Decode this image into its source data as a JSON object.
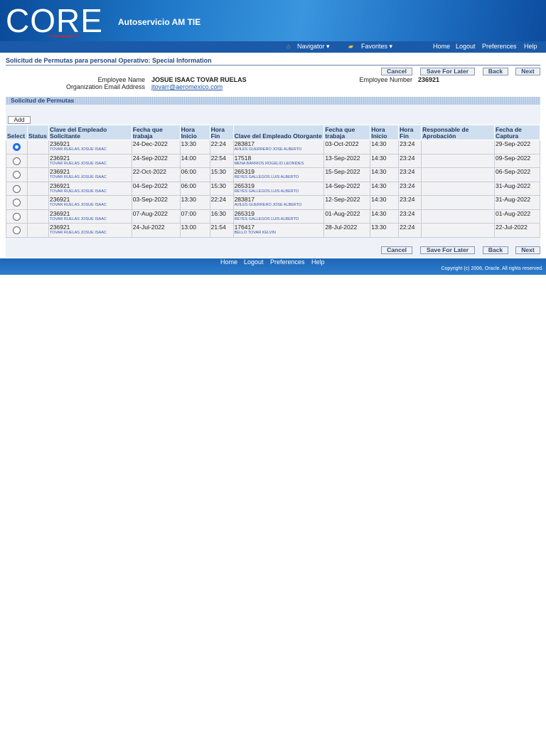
{
  "header": {
    "logo": "CORE",
    "app_title": "Autoservicio AM TIE"
  },
  "nav": {
    "navigator": "Navigator",
    "favorites": "Favorites",
    "home": "Home",
    "logout": "Logout",
    "preferences": "Preferences",
    "help": "Help"
  },
  "page": {
    "title": "Solicitud de Permutas para personal Operativo: Special Information"
  },
  "buttons": {
    "cancel": "Cancel",
    "save": "Save For Later",
    "back": "Back",
    "next": "Next",
    "add": "Add"
  },
  "employee": {
    "name_label": "Employee Name",
    "name": "JOSUE ISAAC TOVAR RUELAS",
    "email_label": "Organization Email Address",
    "email": "jtovarr@aeromexico.com",
    "number_label": "Employee Number",
    "number": "236921"
  },
  "section": {
    "title": "Solicitud de Permutas"
  },
  "table": {
    "headers": [
      "Select",
      "Status",
      "Clave del Empleado Solicitante",
      "Fecha que trabaja",
      "Hora Inicio",
      "Hora Fin",
      "Clave del Empleado Otorgante",
      "Fecha que trabaja",
      "Hora Inicio",
      "Hora Fin",
      "Responsable de Aprobación",
      "Fecha de Captura"
    ],
    "rows": [
      {
        "selected": true,
        "sol_id": "236921",
        "sol_name": "TOVAR RUELAS JOSUE ISAAC",
        "fecha1": "24-Dec-2022",
        "ini1": "13:30",
        "fin1": "22:24",
        "otg_id": "283817",
        "otg_name": "AVILES GUERRERO JOSE ALBERTO",
        "fecha2": "03-Oct-2022",
        "ini2": "14:30",
        "fin2": "23:24",
        "resp": "",
        "captura": "29-Sep-2022"
      },
      {
        "selected": false,
        "sol_id": "236921",
        "sol_name": "TOVAR RUELAS JOSUE ISAAC",
        "fecha1": "24-Sep-2022",
        "ini1": "14:00",
        "fin1": "22:54",
        "otg_id": "17518",
        "otg_name": "MENA BARRIOS ROGELIO LEONIDES",
        "fecha2": "13-Sep-2022",
        "ini2": "14:30",
        "fin2": "23:24",
        "resp": "",
        "captura": "09-Sep-2022"
      },
      {
        "selected": false,
        "sol_id": "236921",
        "sol_name": "TOVAR RUELAS JOSUE ISAAC",
        "fecha1": "22-Oct-2022",
        "ini1": "06:00",
        "fin1": "15:30",
        "otg_id": "265319",
        "otg_name": "REYES GALLEGOS LUIS ALBERTO",
        "fecha2": "15-Sep-2022",
        "ini2": "14:30",
        "fin2": "23:24",
        "resp": "",
        "captura": "06-Sep-2022"
      },
      {
        "selected": false,
        "sol_id": "236921",
        "sol_name": "TOVAR RUELAS JOSUE ISAAC",
        "fecha1": "04-Sep-2022",
        "ini1": "06:00",
        "fin1": "15:30",
        "otg_id": "265319",
        "otg_name": "REYES GALLEGOS LUIS ALBERTO",
        "fecha2": "14-Sep-2022",
        "ini2": "14:30",
        "fin2": "23:24",
        "resp": "",
        "captura": "31-Aug-2022"
      },
      {
        "selected": false,
        "sol_id": "236921",
        "sol_name": "TOVAR RUELAS JOSUE ISAAC",
        "fecha1": "03-Sep-2022",
        "ini1": "13:30",
        "fin1": "22:24",
        "otg_id": "283817",
        "otg_name": "AVILES GUERRERO JOSE ALBERTO",
        "fecha2": "12-Sep-2022",
        "ini2": "14:30",
        "fin2": "23:24",
        "resp": "",
        "captura": "31-Aug-2022"
      },
      {
        "selected": false,
        "sol_id": "236921",
        "sol_name": "TOVAR RUELAS JOSUE ISAAC",
        "fecha1": "07-Aug-2022",
        "ini1": "07:00",
        "fin1": "16:30",
        "otg_id": "265319",
        "otg_name": "REYES GALLEGOS LUIS ALBERTO",
        "fecha2": "01-Aug-2022",
        "ini2": "14:30",
        "fin2": "23:24",
        "resp": "",
        "captura": "01-Aug-2022"
      },
      {
        "selected": false,
        "sol_id": "236921",
        "sol_name": "TOVAR RUELAS JOSUE ISAAC",
        "fecha1": "24-Jul-2022",
        "ini1": "13:00",
        "fin1": "21:54",
        "otg_id": "176417",
        "otg_name": "BELLO TOVAR KELVIN",
        "fecha2": "28-Jul-2022",
        "ini2": "13:30",
        "fin2": "22:24",
        "resp": "",
        "captura": "22-Jul-2022"
      }
    ]
  },
  "footer": {
    "home": "Home",
    "logout": "Logout",
    "preferences": "Preferences",
    "help": "Help",
    "copyright": "Copyright (c) 2006, Oracle. All rights reserved."
  }
}
